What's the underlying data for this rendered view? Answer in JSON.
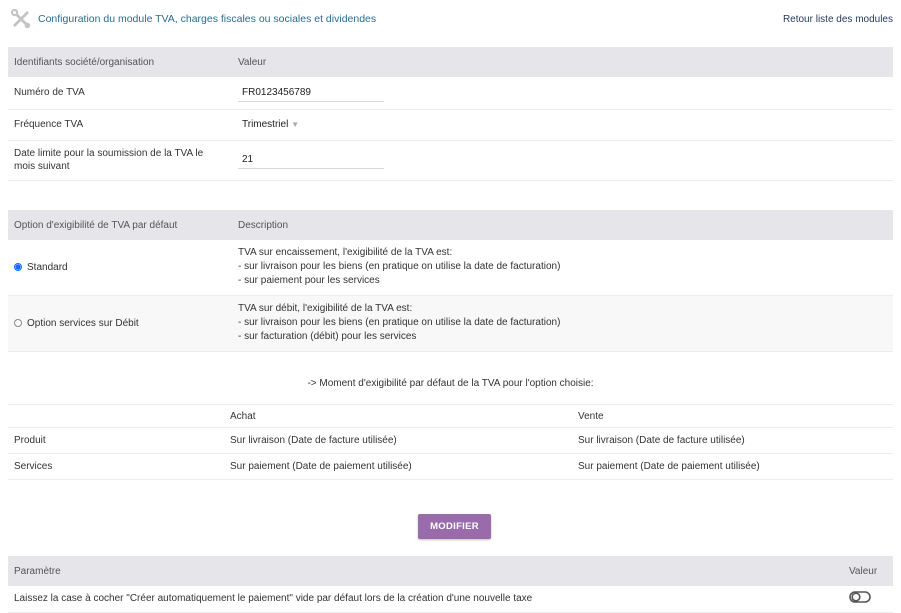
{
  "header": {
    "title": "Configuration du module TVA, charges fiscales ou sociales et dividendes",
    "back_link": "Retour liste des modules"
  },
  "company_table": {
    "col1": "Identifiants société/organisation",
    "col2": "Valeur",
    "rows": [
      {
        "label": "Numéro de TVA",
        "value": "FR0123456789"
      },
      {
        "label": "Fréquence TVA",
        "value": "Trimestriel"
      },
      {
        "label": "Date limite pour la soumission de la TVA le mois suivant",
        "value": "21"
      }
    ]
  },
  "option_table": {
    "col1": "Option d'exigibilité de TVA par défaut",
    "col2": "Description",
    "options": [
      {
        "label": "Standard",
        "selected": true,
        "lines": [
          "TVA sur encaissement, l'exigibilité de la TVA est:",
          "- sur livraison pour les biens (en pratique on utilise la date de facturation)",
          "- sur paiement pour les services"
        ]
      },
      {
        "label": "Option services sur Débit",
        "selected": false,
        "lines": [
          "TVA sur débit, l'exigibilité de la TVA est:",
          "- sur livraison pour les biens (en pratique on utilise la date de facturation)",
          "- sur facturation (débit) pour les services"
        ]
      }
    ]
  },
  "moment": {
    "text": "-> Moment d'exigibilité par défaut de la TVA pour l'option choisie:",
    "col_achat": "Achat",
    "col_vente": "Vente",
    "rows": [
      {
        "label": "Produit",
        "achat": "Sur livraison (Date de facture utilisée)",
        "vente": "Sur livraison (Date de facture utilisée)"
      },
      {
        "label": "Services",
        "achat": "Sur paiement (Date de paiement utilisée)",
        "vente": "Sur paiement (Date de paiement utilisée)"
      }
    ]
  },
  "buttons": {
    "modify": "MODIFIER"
  },
  "param_table": {
    "col1": "Paramètre",
    "col2": "Valeur",
    "rows": [
      {
        "label": "Laissez la case à cocher \"Créer automatiquement le paiement\" vide par défaut lors de la création d'une nouvelle taxe",
        "toggle_state": "off"
      }
    ]
  },
  "colors": {
    "accent_button": "#9a6bab",
    "title": "#2c6b8e",
    "header_bg": "#e6e6ea",
    "radio_selected": "#0b6cff"
  },
  "icons": {
    "title": "tools-icon",
    "select": "caret-down-icon",
    "toggle": "toggle-off-icon"
  }
}
